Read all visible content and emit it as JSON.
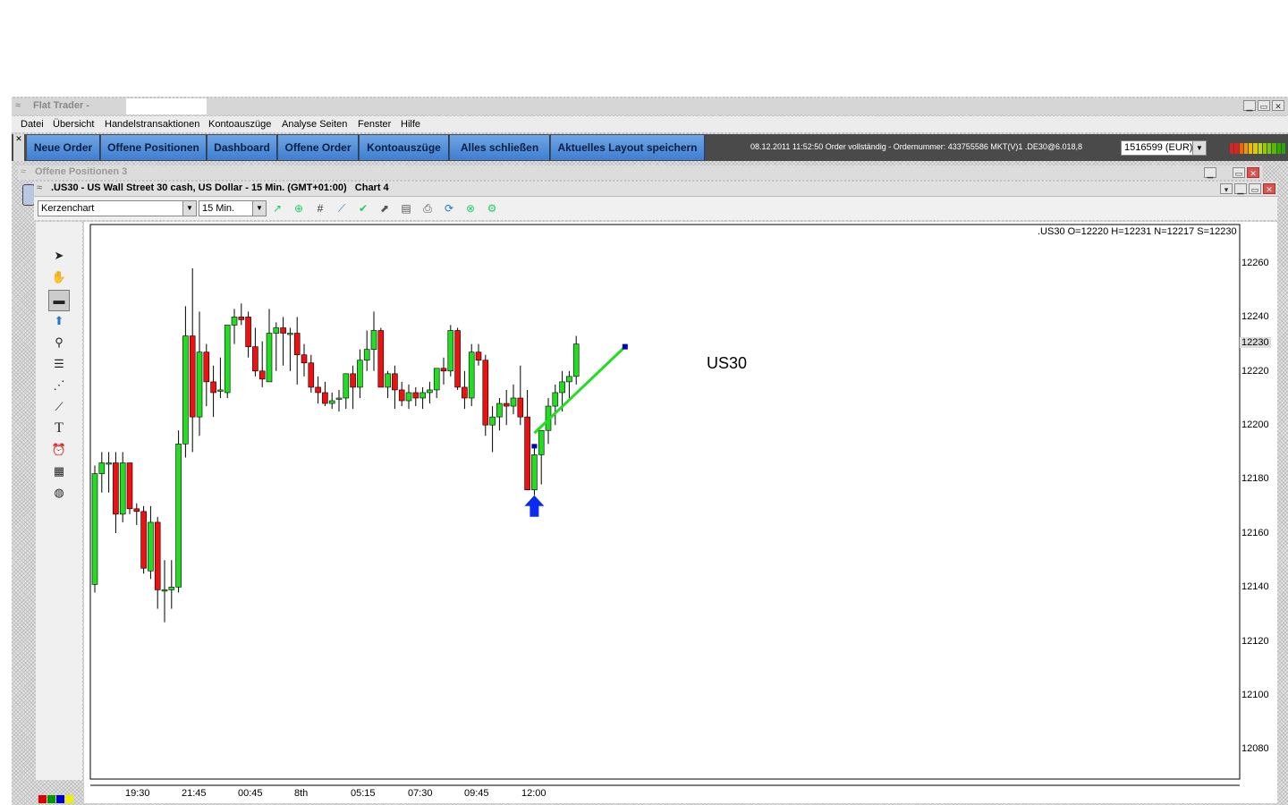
{
  "app": {
    "title": "Flat Trader -",
    "menu": [
      "Datei",
      "Übersicht",
      "Handelstransaktionen",
      "Kontoauszüge",
      "Analyse Seiten",
      "Fenster",
      "Hilfe"
    ]
  },
  "nav": {
    "buttons": [
      "Neue Order",
      "Offene Positionen",
      "Dashboard",
      "Offene Order",
      "Kontoauszüge",
      "Alles schließen",
      "Aktuelles Layout speichern"
    ],
    "status": "08.12.2011 11:52:50 Order vollständig - Ordernummer: 433755586 MKT(V)1 .DE30@6.018,8",
    "account": "1516599 (EUR)"
  },
  "panel": {
    "title": "Offene Positionen 3"
  },
  "chart_window": {
    "title": ".US30 - US Wall Street 30 cash, US Dollar - 15 Min. (GMT+01:00)   Chart 4",
    "chart_type_select": "Kerzenchart",
    "timeframe_select": "15 Min.",
    "ohlc": ".US30 O=12220 H=12231 N=12217 S=12230",
    "current_price": "12230",
    "annotation": "US30"
  },
  "chart_data": {
    "type": "candlestick",
    "title": ".US30 - US Wall Street 30 cash, US Dollar - 15 Min. (GMT+01:00)",
    "ylim": [
      12067,
      12267
    ],
    "y_ticks": [
      12260,
      12240,
      12220,
      12200,
      12180,
      12160,
      12140,
      12120,
      12100,
      12080
    ],
    "x_ticks": [
      "19:30",
      "21:45",
      "00:45",
      "8th",
      "05:15",
      "07:30",
      "09:45",
      "12:00"
    ],
    "current_price": 12230,
    "candles": [
      {
        "o": 12141,
        "h": 12185,
        "l": 12138,
        "c": 12182
      },
      {
        "o": 12182,
        "h": 12190,
        "l": 12175,
        "c": 12186
      },
      {
        "o": 12186,
        "h": 12190,
        "l": 12175,
        "c": 12186
      },
      {
        "o": 12186,
        "h": 12190,
        "l": 12160,
        "c": 12167
      },
      {
        "o": 12167,
        "h": 12190,
        "l": 12164,
        "c": 12186
      },
      {
        "o": 12186,
        "h": 12186,
        "l": 12167,
        "c": 12169
      },
      {
        "o": 12169,
        "h": 12171,
        "l": 12163,
        "c": 12168
      },
      {
        "o": 12168,
        "h": 12170,
        "l": 12145,
        "c": 12147
      },
      {
        "o": 12146,
        "h": 12170,
        "l": 12143,
        "c": 12164
      },
      {
        "o": 12164,
        "h": 12166,
        "l": 12132,
        "c": 12139
      },
      {
        "o": 12139,
        "h": 12150,
        "l": 12127,
        "c": 12139
      },
      {
        "o": 12139,
        "h": 12150,
        "l": 12132,
        "c": 12140
      },
      {
        "o": 12140,
        "h": 12198,
        "l": 12138,
        "c": 12193
      },
      {
        "o": 12193,
        "h": 12244,
        "l": 12188,
        "c": 12233
      },
      {
        "o": 12233,
        "h": 12258,
        "l": 12190,
        "c": 12203
      },
      {
        "o": 12203,
        "h": 12242,
        "l": 12196,
        "c": 12227
      },
      {
        "o": 12227,
        "h": 12230,
        "l": 12207,
        "c": 12216
      },
      {
        "o": 12216,
        "h": 12222,
        "l": 12203,
        "c": 12212
      },
      {
        "o": 12213,
        "h": 12225,
        "l": 12210,
        "c": 12213
      },
      {
        "o": 12212,
        "h": 12237,
        "l": 12210,
        "c": 12237
      },
      {
        "o": 12237,
        "h": 12243,
        "l": 12230,
        "c": 12240
      },
      {
        "o": 12240,
        "h": 12245,
        "l": 12237,
        "c": 12239
      },
      {
        "o": 12240,
        "h": 12242,
        "l": 12225,
        "c": 12229
      },
      {
        "o": 12229,
        "h": 12236,
        "l": 12218,
        "c": 12220
      },
      {
        "o": 12220,
        "h": 12231,
        "l": 12214,
        "c": 12217
      },
      {
        "o": 12216,
        "h": 12243,
        "l": 12216,
        "c": 12234
      },
      {
        "o": 12234,
        "h": 12238,
        "l": 12220,
        "c": 12236
      },
      {
        "o": 12236,
        "h": 12240,
        "l": 12222,
        "c": 12234
      },
      {
        "o": 12234,
        "h": 12236,
        "l": 12220,
        "c": 12234
      },
      {
        "o": 12234,
        "h": 12240,
        "l": 12215,
        "c": 12226
      },
      {
        "o": 12226,
        "h": 12230,
        "l": 12218,
        "c": 12223
      },
      {
        "o": 12223,
        "h": 12226,
        "l": 12212,
        "c": 12214
      },
      {
        "o": 12214,
        "h": 12218,
        "l": 12208,
        "c": 12212
      },
      {
        "o": 12212,
        "h": 12216,
        "l": 12207,
        "c": 12208
      },
      {
        "o": 12208,
        "h": 12212,
        "l": 12206,
        "c": 12209
      },
      {
        "o": 12210,
        "h": 12213,
        "l": 12205,
        "c": 12210
      },
      {
        "o": 12210,
        "h": 12218,
        "l": 12206,
        "c": 12219
      },
      {
        "o": 12219,
        "h": 12222,
        "l": 12206,
        "c": 12214
      },
      {
        "o": 12214,
        "h": 12228,
        "l": 12210,
        "c": 12224
      },
      {
        "o": 12224,
        "h": 12235,
        "l": 12220,
        "c": 12228
      },
      {
        "o": 12228,
        "h": 12242,
        "l": 12220,
        "c": 12235
      },
      {
        "o": 12235,
        "h": 12236,
        "l": 12220,
        "c": 12214
      },
      {
        "o": 12214,
        "h": 12220,
        "l": 12210,
        "c": 12219
      },
      {
        "o": 12219,
        "h": 12222,
        "l": 12206,
        "c": 12213
      },
      {
        "o": 12213,
        "h": 12216,
        "l": 12207,
        "c": 12209
      },
      {
        "o": 12209,
        "h": 12215,
        "l": 12206,
        "c": 12212
      },
      {
        "o": 12212,
        "h": 12214,
        "l": 12207,
        "c": 12210
      },
      {
        "o": 12210,
        "h": 12214,
        "l": 12206,
        "c": 12212
      },
      {
        "o": 12212,
        "h": 12216,
        "l": 12208,
        "c": 12213
      },
      {
        "o": 12213,
        "h": 12221,
        "l": 12210,
        "c": 12221
      },
      {
        "o": 12221,
        "h": 12225,
        "l": 12215,
        "c": 12220
      },
      {
        "o": 12220,
        "h": 12237,
        "l": 12218,
        "c": 12235
      },
      {
        "o": 12235,
        "h": 12236,
        "l": 12213,
        "c": 12214
      },
      {
        "o": 12214,
        "h": 12220,
        "l": 12206,
        "c": 12210
      },
      {
        "o": 12210,
        "h": 12230,
        "l": 12207,
        "c": 12227
      },
      {
        "o": 12227,
        "h": 12230,
        "l": 12222,
        "c": 12224
      },
      {
        "o": 12224,
        "h": 12226,
        "l": 12196,
        "c": 12200
      },
      {
        "o": 12200,
        "h": 12207,
        "l": 12190,
        "c": 12203
      },
      {
        "o": 12203,
        "h": 12210,
        "l": 12198,
        "c": 12208
      },
      {
        "o": 12208,
        "h": 12213,
        "l": 12200,
        "c": 12207
      },
      {
        "o": 12207,
        "h": 12215,
        "l": 12204,
        "c": 12210
      },
      {
        "o": 12210,
        "h": 12222,
        "l": 12200,
        "c": 12203
      },
      {
        "o": 12203,
        "h": 12213,
        "l": 12190,
        "c": 12176
      },
      {
        "o": 12176,
        "h": 12192,
        "l": 12174,
        "c": 12189
      },
      {
        "o": 12189,
        "h": 12198,
        "l": 12178,
        "c": 12198
      },
      {
        "o": 12198,
        "h": 12210,
        "l": 12193,
        "c": 12207
      },
      {
        "o": 12207,
        "h": 12215,
        "l": 12200,
        "c": 12212
      },
      {
        "o": 12212,
        "h": 12220,
        "l": 12205,
        "c": 12216
      },
      {
        "o": 12216,
        "h": 12220,
        "l": 12210,
        "c": 12218
      },
      {
        "o": 12218,
        "h": 12233,
        "l": 12215,
        "c": 12230
      }
    ],
    "trend_line": {
      "from": [
        63,
        12197
      ],
      "to": [
        76,
        12229
      ]
    },
    "marker": {
      "candle": 63,
      "price": 12192
    },
    "arrow": {
      "candle": 63,
      "price": 12170
    }
  }
}
